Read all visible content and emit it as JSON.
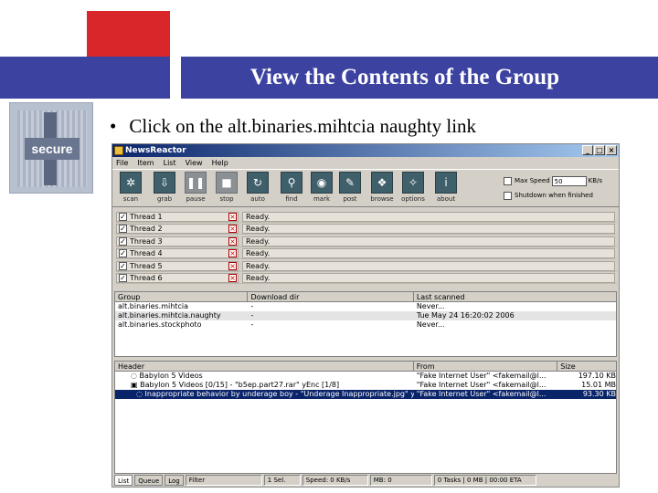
{
  "slide": {
    "title": "View the Contents of the Group",
    "bullet": "Click on the alt.binaries.mihtcia naughty link",
    "logo_text": "secure"
  },
  "window": {
    "title": "NewsReactor",
    "menus": [
      "File",
      "Item",
      "List",
      "View",
      "Help"
    ],
    "toolbar": [
      {
        "label": "scan",
        "icon": "scan-icon",
        "glyph": "✲",
        "enabled": true
      },
      {
        "label": "grab",
        "icon": "grab-icon",
        "glyph": "⇩",
        "enabled": true
      },
      {
        "label": "pause",
        "icon": "pause-icon",
        "glyph": "❚❚",
        "enabled": false
      },
      {
        "label": "stop",
        "icon": "stop-icon",
        "glyph": "■",
        "enabled": false
      },
      {
        "label": "auto",
        "icon": "auto-icon",
        "glyph": "↻",
        "enabled": true
      },
      {
        "label": "find",
        "icon": "find-icon",
        "glyph": "⚲",
        "enabled": true
      },
      {
        "label": "mark",
        "icon": "mark-icon",
        "glyph": "◉",
        "enabled": true
      },
      {
        "label": "post",
        "icon": "post-icon",
        "glyph": "✎",
        "enabled": true
      },
      {
        "label": "browse",
        "icon": "browse-icon",
        "glyph": "❖",
        "enabled": true
      },
      {
        "label": "options",
        "icon": "options-icon",
        "glyph": "✧",
        "enabled": true
      },
      {
        "label": "about",
        "icon": "about-icon",
        "glyph": "i",
        "enabled": true
      }
    ],
    "options": {
      "max_speed_label": "Max Speed",
      "max_speed_value": "50",
      "max_speed_unit": "KB/s",
      "shutdown_label": "Shutdown when finished"
    },
    "threads": [
      {
        "name": "Thread 1",
        "status": "Ready."
      },
      {
        "name": "Thread 2",
        "status": "Ready."
      },
      {
        "name": "Thread 3",
        "status": "Ready."
      },
      {
        "name": "Thread 4",
        "status": "Ready."
      },
      {
        "name": "Thread 5",
        "status": "Ready."
      },
      {
        "name": "Thread 6",
        "status": "Ready."
      }
    ],
    "groups": {
      "columns": [
        "Group",
        "Download dir",
        "Last scanned"
      ],
      "rows": [
        {
          "group": "alt.binaries.mihtcia",
          "dir": "-",
          "scanned": "Never...",
          "selected": false
        },
        {
          "group": "alt.binaries.mihtcia.naughty",
          "dir": "-",
          "scanned": "Tue May 24 16:20:02 2006",
          "selected": true
        },
        {
          "group": "alt.binaries.stockphoto",
          "dir": "-",
          "scanned": "Never...",
          "selected": false
        }
      ]
    },
    "headers": {
      "columns": [
        "Header",
        "From",
        "Size"
      ],
      "rows": [
        {
          "header": "Babylon 5 Videos",
          "from": "\"Fake Internet User\" <fakemail@l...",
          "size": "197.10 KB",
          "selected": false
        },
        {
          "header": "Babylon 5 Videos [0/15] - \"b5ep.part27.rar\" yEnc [1/8]",
          "from": "\"Fake Internet User\" <fakemail@l...",
          "size": "15.01 MB",
          "selected": false
        },
        {
          "header": "Inappropriate behavior by underage boy - \"Underage Inappropriate.jpg\" yEnc",
          "from": "\"Fake Internet User\" <fakemail@l...",
          "size": "93.30 KB",
          "selected": true
        }
      ]
    },
    "statusbar": {
      "tabs": [
        "List",
        "Queue",
        "Log"
      ],
      "filter_label": "Filter",
      "selected": "1 Sel.",
      "speed": "Speed: 0 KB/s",
      "mb": "MB: 0",
      "tasks": "0 Tasks | 0 MB | 00:00 ETA"
    }
  }
}
